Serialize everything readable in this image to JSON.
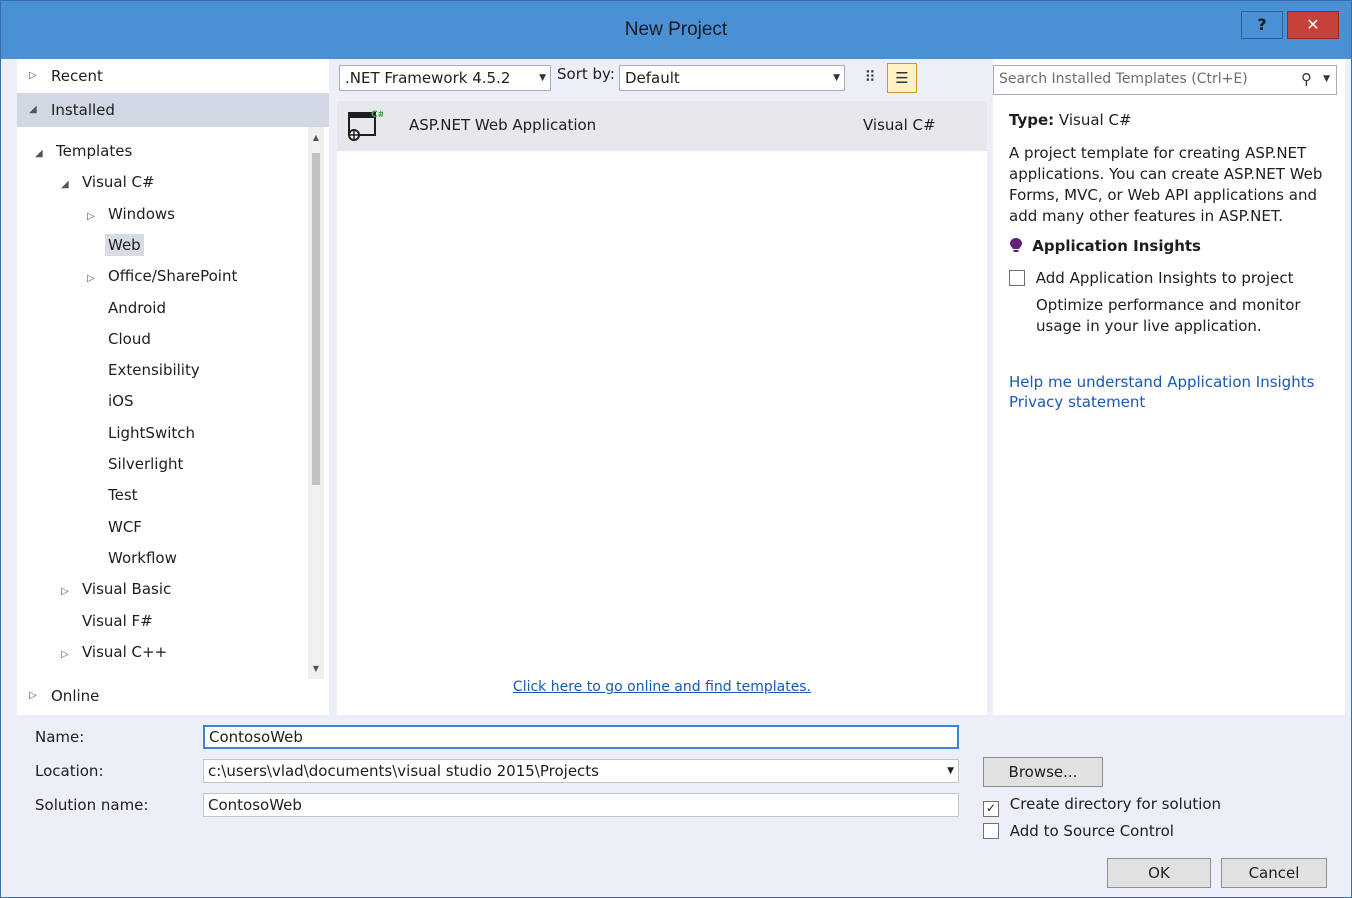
{
  "window": {
    "title": "New Project",
    "help_label": "?",
    "close_label": "✕"
  },
  "left_nav": {
    "recent": "Recent",
    "installed": "Installed",
    "online": "Online",
    "tree": [
      {
        "label": "Templates",
        "level": 0,
        "expander": "◢"
      },
      {
        "label": "Visual C#",
        "level": 1,
        "expander": "◢"
      },
      {
        "label": "Windows",
        "level": 2,
        "expander": "▷"
      },
      {
        "label": "Web",
        "level": 2,
        "expander": "",
        "selected": true
      },
      {
        "label": "Office/SharePoint",
        "level": 2,
        "expander": "▷"
      },
      {
        "label": "Android",
        "level": 2,
        "expander": ""
      },
      {
        "label": "Cloud",
        "level": 2,
        "expander": ""
      },
      {
        "label": "Extensibility",
        "level": 2,
        "expander": ""
      },
      {
        "label": "iOS",
        "level": 2,
        "expander": ""
      },
      {
        "label": "LightSwitch",
        "level": 2,
        "expander": ""
      },
      {
        "label": "Silverlight",
        "level": 2,
        "expander": ""
      },
      {
        "label": "Test",
        "level": 2,
        "expander": ""
      },
      {
        "label": "WCF",
        "level": 2,
        "expander": ""
      },
      {
        "label": "Workflow",
        "level": 2,
        "expander": ""
      },
      {
        "label": "Visual Basic",
        "level": 1,
        "expander": "▷"
      },
      {
        "label": "Visual F#",
        "level": 1,
        "expander": ""
      },
      {
        "label": "Visual C++",
        "level": 1,
        "expander": "▷"
      }
    ]
  },
  "toolbar": {
    "framework": ".NET Framework 4.5.2",
    "sort_label": "Sort by:",
    "sort_value": "Default"
  },
  "templates": [
    {
      "name": "ASP.NET Web Application",
      "language": "Visual C#",
      "icon": "web-application-icon"
    }
  ],
  "online_link": "Click here to go online and find templates.",
  "details": {
    "search_placeholder": "Search Installed Templates (Ctrl+E)",
    "type_label": "Type:",
    "type_value": "Visual C#",
    "description": "A project template for creating ASP.NET applications. You can create ASP.NET Web Forms, MVC,  or Web API applications and add many other features in ASP.NET.",
    "ai_title": "Application Insights",
    "ai_checkbox_label": "Add Application Insights to project",
    "ai_description": "Optimize performance and monitor usage in your live application.",
    "help_link": "Help me understand Application Insights",
    "privacy_link": "Privacy statement"
  },
  "form": {
    "name_label": "Name:",
    "name_value": "ContosoWeb",
    "location_label": "Location:",
    "location_value": "c:\\users\\vlad\\documents\\visual studio 2015\\Projects",
    "solution_label": "Solution name:",
    "solution_value": "ContosoWeb",
    "browse_label": "Browse...",
    "create_dir_label": "Create directory for solution",
    "create_dir_checked": true,
    "source_control_label": "Add to Source Control",
    "source_control_checked": false,
    "ok_label": "OK",
    "cancel_label": "Cancel"
  }
}
